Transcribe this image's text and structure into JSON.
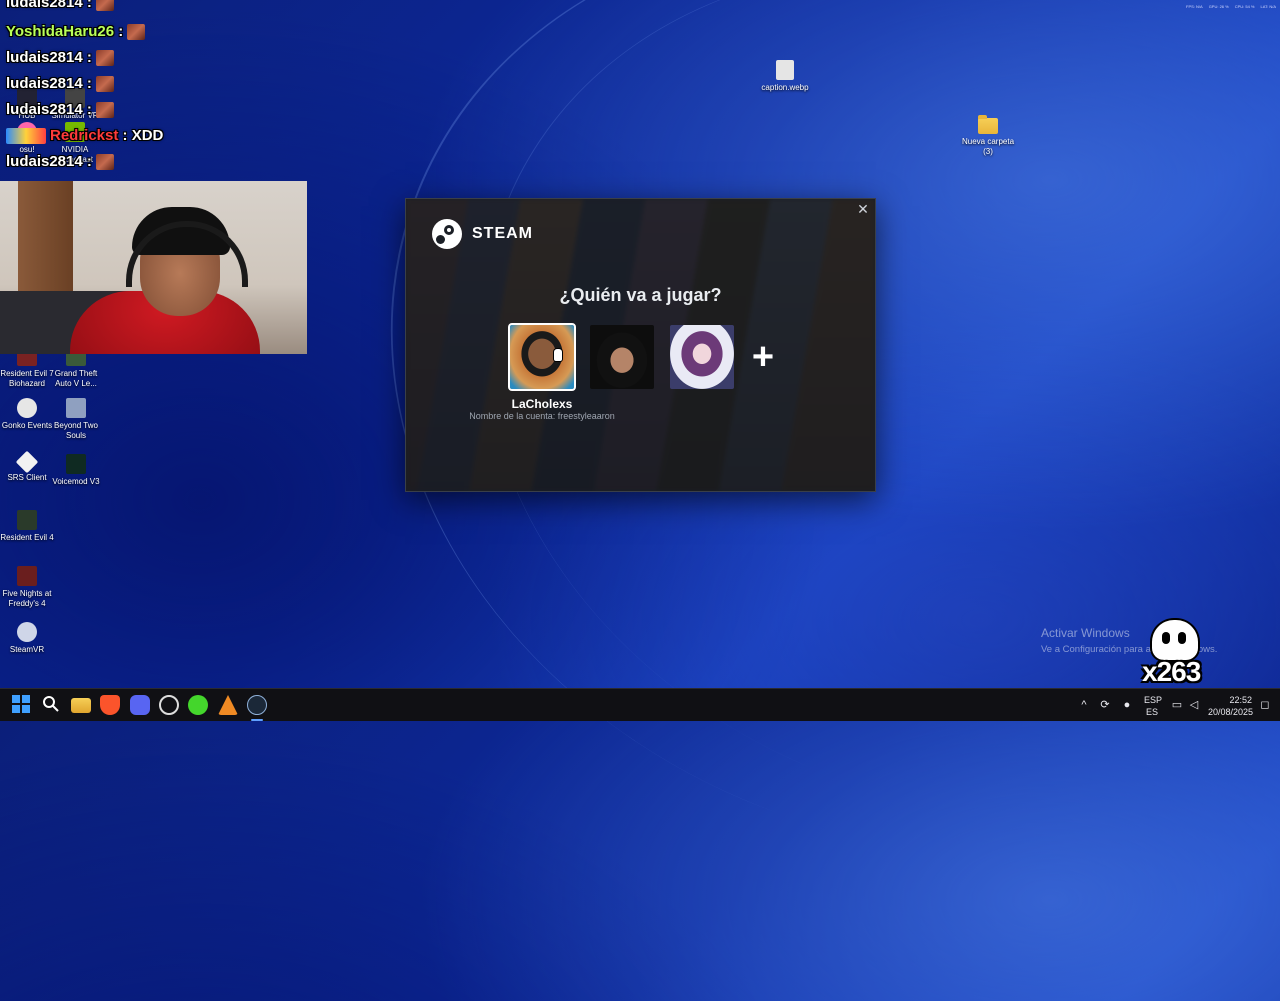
{
  "chat": [
    {
      "user": "ludais2814",
      "suffix": " :",
      "user_color": "#ffffff",
      "emote": true
    },
    {
      "user": "YoshidaHaru26",
      "suffix": " :",
      "user_color": "#b9ff5a",
      "emote": true
    },
    {
      "user": "ludais2814",
      "suffix": " :",
      "user_color": "#ffffff",
      "emote": true
    },
    {
      "user": "ludais2814",
      "suffix": " :",
      "user_color": "#ffffff",
      "emote": true
    },
    {
      "user": "ludais2814",
      "suffix": " :",
      "user_color": "#ffffff",
      "emote": true
    },
    {
      "user": "Redrickst",
      "suffix": " : XDD",
      "user_color": "#ff3b3b",
      "emote": false
    },
    {
      "user": "ludais2814",
      "suffix": " :",
      "user_color": "#ffffff",
      "emote": true
    }
  ],
  "desktop_icons_behind": [
    "HUB",
    "Simulator VR",
    "osu!",
    "NVIDIA Broadcast"
  ],
  "desktop_icons": [
    {
      "label": "Resident Evil 7 Biohazard",
      "icon": "re7-icon"
    },
    {
      "label": "Grand Theft Auto V Le...",
      "icon": "gta-icon"
    },
    {
      "label": "Gonko Events",
      "icon": "gonko-icon"
    },
    {
      "label": "Beyond Two Souls",
      "icon": "beyond-icon"
    },
    {
      "label": "SRS Client",
      "icon": "srs-icon"
    },
    {
      "label": "Voicemod V3",
      "icon": "voicemod-icon"
    },
    {
      "label": "Resident Evil 4",
      "icon": "re4-icon"
    },
    {
      "label": "Five Nights at Freddy's 4",
      "icon": "fnaf-icon"
    },
    {
      "label": "SteamVR",
      "icon": "steamvr-icon"
    },
    {
      "label": "caption.webp",
      "icon": "image-file-icon"
    },
    {
      "label": "Nueva carpeta (3)",
      "icon": "folder-icon"
    }
  ],
  "steam": {
    "brand": "STEAM",
    "title": "¿Quién va a jugar?",
    "account_name": "LaCholexs",
    "account_sub": "Nombre de la cuenta: freestyleaaron",
    "add_label": "+",
    "close_label": "✕"
  },
  "watermark": {
    "line1": "Activar Windows",
    "line2": "Ve a Configuración para activar Windows."
  },
  "overlay_badge": "x263",
  "perf": [
    "FPS: N/A",
    "GPU: 26 %",
    "CPU: 54 %",
    "LAT: N/A"
  ],
  "taskbar": {
    "lang_top": "ESP",
    "lang_bottom": "ES",
    "time": "22:52",
    "date": "20/08/2025",
    "apps": [
      "windows-start-icon",
      "search-icon",
      "file-explorer-icon",
      "brave-icon",
      "discord-icon",
      "obs-icon",
      "razer-icon",
      "vlc-icon",
      "steam-icon"
    ]
  }
}
